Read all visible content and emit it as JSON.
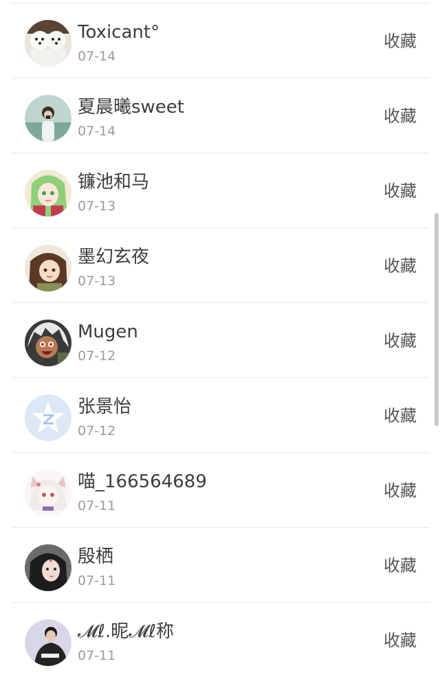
{
  "items": [
    {
      "name": "Toxicant°",
      "date": "07-14",
      "action": "收藏",
      "avatar": "avatar-dogs"
    },
    {
      "name": "夏晨曦sweet",
      "date": "07-14",
      "action": "收藏",
      "avatar": "avatar-girl-photo"
    },
    {
      "name": "镰池和马",
      "date": "07-13",
      "action": "收藏",
      "avatar": "avatar-anime-green-hair"
    },
    {
      "name": "墨幻玄夜",
      "date": "07-13",
      "action": "收藏",
      "avatar": "avatar-anime-brown-hair"
    },
    {
      "name": "Mugen",
      "date": "07-12",
      "action": "收藏",
      "avatar": "avatar-anime-white-hair"
    },
    {
      "name": "张景怡",
      "date": "07-12",
      "action": "收藏",
      "avatar": "avatar-default-star"
    },
    {
      "name": "喵_166564689",
      "date": "07-11",
      "action": "收藏",
      "avatar": "avatar-anime-catgirl"
    },
    {
      "name": "殷栖",
      "date": "07-11",
      "action": "收藏",
      "avatar": "avatar-dark-hair-girl"
    },
    {
      "name": "𝓜ℓ.昵𝓜ℓ称",
      "date": "07-11",
      "action": "收藏",
      "avatar": "avatar-boy-photo"
    }
  ],
  "colors": {
    "name_text": "#3d3d3d",
    "date_text": "#9a9a9a",
    "action_text": "#555555",
    "divider": "#e6e6e6"
  }
}
